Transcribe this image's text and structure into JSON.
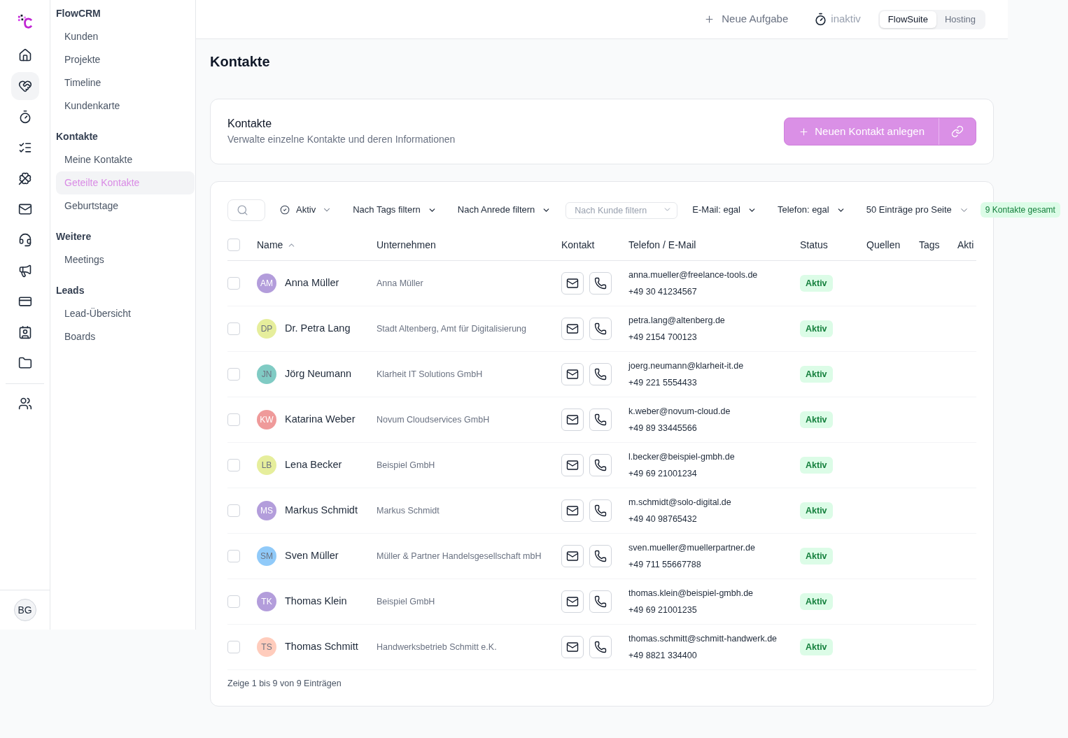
{
  "icon_rail": {
    "nav_items": [
      {
        "selected": false
      },
      {
        "selected": true
      },
      {
        "selected": false
      },
      {
        "selected": false
      },
      {
        "selected": false
      },
      {
        "selected": false
      },
      {
        "selected": false
      },
      {
        "selected": false
      },
      {
        "selected": false
      },
      {
        "selected": false
      },
      {
        "selected": false
      }
    ],
    "bottom_items": [
      {
        "selected": false
      }
    ],
    "user": {
      "initials": "BG"
    }
  },
  "sidebar": {
    "sections": [
      {
        "title": "FlowCRM",
        "items": [
          {
            "label": "Kunden",
            "selected": false
          },
          {
            "label": "Projekte",
            "selected": false
          },
          {
            "label": "Timeline",
            "selected": false
          },
          {
            "label": "Kundenkarte",
            "selected": false
          }
        ]
      },
      {
        "title": "Kontakte",
        "items": [
          {
            "label": "Meine Kontakte",
            "selected": false
          },
          {
            "label": "Geteilte Kontakte",
            "selected": true
          },
          {
            "label": "Geburtstage",
            "selected": false
          }
        ]
      },
      {
        "title": "Weitere",
        "items": [
          {
            "label": "Meetings",
            "selected": false
          }
        ]
      },
      {
        "title": "Leads",
        "items": [
          {
            "label": "Lead-Übersicht",
            "selected": false
          },
          {
            "label": "Boards",
            "selected": false
          }
        ]
      }
    ]
  },
  "top_bar": {
    "new_task_button": "Neue Aufgabe",
    "timer": {
      "status": "inaktiv"
    },
    "workspace_switch": [
      {
        "label": "FlowSuite",
        "selected": true
      },
      {
        "label": "Hosting",
        "selected": false
      }
    ]
  },
  "page_title": "Kontakte",
  "header_card": {
    "title": "Kontakte",
    "subtitle": "Verwalte einzelne Kontakte und deren Informationen",
    "primary_button": "Neuen Kontakt anlegen"
  },
  "filters": [
    {
      "kind": "search"
    },
    {
      "kind": "status",
      "label": "Aktiv"
    },
    {
      "kind": "dropdown",
      "label": "Nach Tags filtern"
    },
    {
      "kind": "dropdown",
      "label": "Nach Anrede filtern"
    },
    {
      "kind": "select",
      "placeholder": "Nach Kunde filtern"
    },
    {
      "kind": "dropdown",
      "label": "E-Mail: egal"
    },
    {
      "kind": "dropdown",
      "label": "Telefon: egal"
    },
    {
      "kind": "page_size",
      "label": "50 Einträge pro Seite"
    }
  ],
  "total_badge": "9 Kontakte gesamt",
  "table": {
    "select_all": {
      "checked": false
    },
    "columns": [
      {
        "label": "Name",
        "sorted": true
      },
      {
        "label": "Unternehmen",
        "sorted": false
      },
      {
        "label": "Kontakt",
        "sorted": false
      },
      {
        "label": "Telefon / E-Mail",
        "sorted": false
      },
      {
        "label": "Status",
        "sorted": false
      },
      {
        "label": "Quellen",
        "sorted": false
      },
      {
        "label": "Tags",
        "sorted": false
      },
      {
        "label": "Akti",
        "sorted": false
      }
    ],
    "rows": [
      {
        "checked": false,
        "initials": "AM",
        "color": "#b39ddb",
        "name": "Anna Müller",
        "company": "Anna Müller",
        "email": "anna.mueller@freelance-tools.de",
        "phone": "+49 30 41234567",
        "status": "Aktiv"
      },
      {
        "checked": false,
        "initials": "DP",
        "color": "#e6ee9c",
        "name": "Dr. Petra Lang",
        "company": "Stadt Altenberg, Amt für Digitalisierung",
        "email": "petra.lang@altenberg.de",
        "phone": "+49 2154 700123",
        "status": "Aktiv"
      },
      {
        "checked": false,
        "initials": "JN",
        "color": "#80cbc4",
        "name": "Jörg Neumann",
        "company": "Klarheit IT Solutions GmbH",
        "email": "joerg.neumann@klarheit-it.de",
        "phone": "+49 221 5554433",
        "status": "Aktiv"
      },
      {
        "checked": false,
        "initials": "KW",
        "color": "#ef9a9a",
        "name": "Katarina Weber",
        "company": "Novum Cloudservices GmbH",
        "email": "k.weber@novum-cloud.de",
        "phone": "+49 89 33445566",
        "status": "Aktiv"
      },
      {
        "checked": false,
        "initials": "LB",
        "color": "#e6ee9c",
        "name": "Lena Becker",
        "company": "Beispiel GmbH",
        "email": "l.becker@beispiel-gmbh.de",
        "phone": "+49 69 21001234",
        "status": "Aktiv"
      },
      {
        "checked": false,
        "initials": "MS",
        "color": "#b39ddb",
        "name": "Markus Schmidt",
        "company": "Markus Schmidt",
        "email": "m.schmidt@solo-digital.de",
        "phone": "+49 40 98765432",
        "status": "Aktiv"
      },
      {
        "checked": false,
        "initials": "SM",
        "color": "#90caf9",
        "name": "Sven Müller",
        "company": "Müller & Partner Handelsgesellschaft mbH",
        "email": "sven.mueller@muellerpartner.de",
        "phone": "+49 711 55667788",
        "status": "Aktiv"
      },
      {
        "checked": false,
        "initials": "TK",
        "color": "#b39ddb",
        "name": "Thomas Klein",
        "company": "Beispiel GmbH",
        "email": "thomas.klein@beispiel-gmbh.de",
        "phone": "+49 69 21001235",
        "status": "Aktiv"
      },
      {
        "checked": false,
        "initials": "TS",
        "color": "#ffccbc",
        "name": "Thomas Schmitt",
        "company": "Handwerksbetrieb Schmitt e.K.",
        "email": "thomas.schmitt@schmitt-handwerk.de",
        "phone": "+49 8821 334400",
        "status": "Aktiv"
      }
    ]
  },
  "footer": "Zeige 1 bis 9 von 9 Einträgen"
}
